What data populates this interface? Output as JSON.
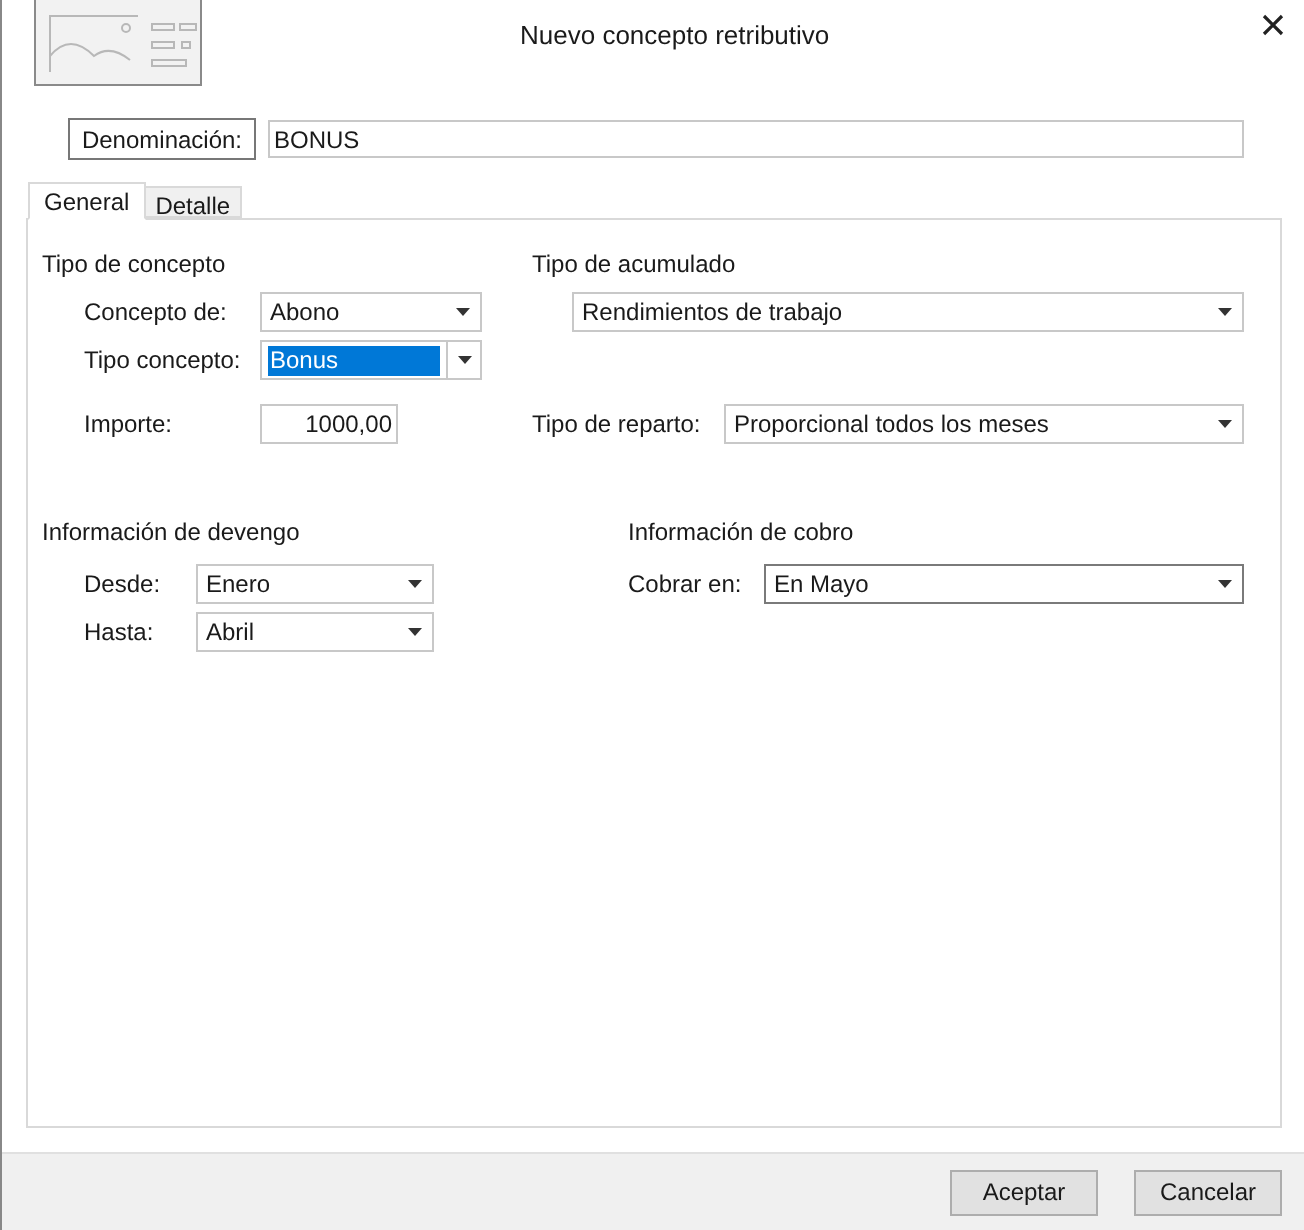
{
  "window": {
    "title": "Nuevo concepto retributivo"
  },
  "denominacion": {
    "label": "Denominación:",
    "value": "BONUS"
  },
  "tabs": [
    {
      "label": "General",
      "selected": true
    },
    {
      "label": "Detalle",
      "selected": false
    }
  ],
  "tipo_concepto": {
    "title": "Tipo de concepto",
    "fields": [
      {
        "label": "Concepto de:",
        "kind": "combo",
        "value": "Abono",
        "highlighted": false
      },
      {
        "label": "Tipo concepto:",
        "kind": "combo",
        "value": "Bonus",
        "highlighted": true
      },
      {
        "label": "Importe:",
        "kind": "number",
        "value": "1000,00"
      }
    ]
  },
  "tipo_acumulado": {
    "title": "Tipo de acumulado",
    "value": "Rendimientos de trabajo"
  },
  "tipo_reparto": {
    "label": "Tipo de reparto:",
    "value": "Proporcional todos los meses"
  },
  "devengo": {
    "title": "Información de devengo",
    "fields": [
      {
        "label": "Desde:",
        "value": "Enero"
      },
      {
        "label": "Hasta:",
        "value": "Abril"
      }
    ]
  },
  "cobro": {
    "title": "Información de cobro",
    "fields": [
      {
        "label": "Cobrar en:",
        "value": "En Mayo"
      }
    ]
  },
  "buttons": [
    "Aceptar",
    "Cancelar"
  ]
}
